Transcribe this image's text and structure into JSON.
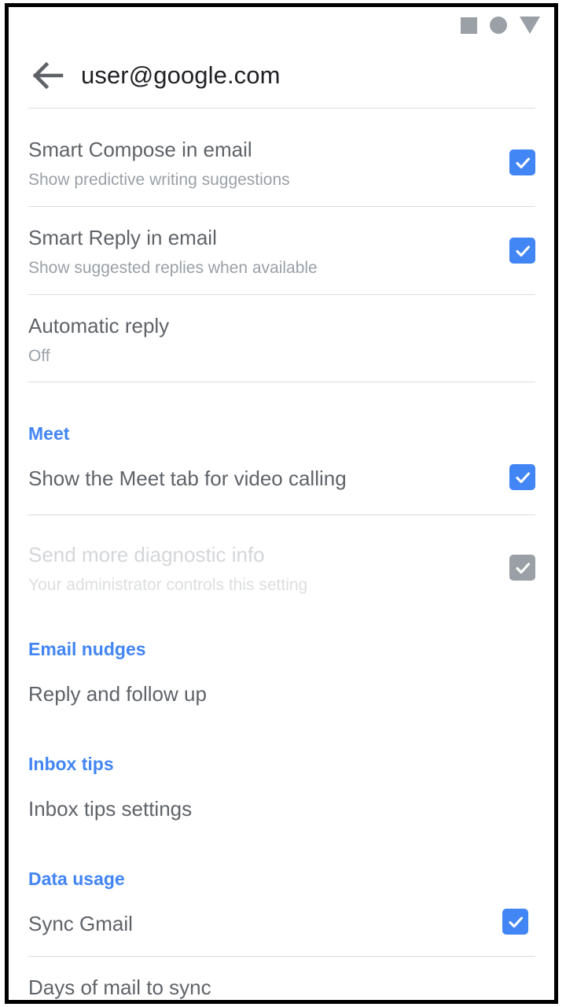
{
  "status_bar": {
    "icons": [
      "square-icon",
      "circle-icon",
      "triangle-down-icon"
    ],
    "color": "#9aa0a6"
  },
  "app_bar": {
    "back_icon": "arrow-back-icon",
    "title": "user@google.com"
  },
  "theme": {
    "accent": "#4285f4",
    "title_text": "#5f6368",
    "subtitle_text": "#9aa0a6",
    "disabled_text": "#d4d6d9",
    "disabled_checkbox": "#9aa0a6",
    "divider": "#dadce0"
  },
  "settings": [
    {
      "kind": "row",
      "title": "Smart Compose in email",
      "subtitle": "Show predictive writing suggestions",
      "checkbox": {
        "checked": true,
        "enabled": true
      }
    },
    {
      "kind": "row",
      "title": "Smart Reply in email",
      "subtitle": "Show suggested replies when available",
      "checkbox": {
        "checked": true,
        "enabled": true
      }
    },
    {
      "kind": "row",
      "title": "Automatic reply",
      "subtitle": "Off",
      "checkbox": null
    },
    {
      "kind": "section",
      "label": "Meet"
    },
    {
      "kind": "row",
      "title": "Show the Meet tab for video calling",
      "subtitle": null,
      "checkbox": {
        "checked": true,
        "enabled": true
      }
    },
    {
      "kind": "row",
      "title": "Send more diagnostic info",
      "subtitle": "Your administrator controls this setting",
      "checkbox": {
        "checked": true,
        "enabled": false
      }
    },
    {
      "kind": "section",
      "label": "Email nudges"
    },
    {
      "kind": "row",
      "title": "Reply and follow up",
      "subtitle": null,
      "checkbox": null
    },
    {
      "kind": "section",
      "label": "Inbox tips"
    },
    {
      "kind": "row",
      "title": "Inbox tips settings",
      "subtitle": null,
      "checkbox": null
    },
    {
      "kind": "section",
      "label": "Data usage"
    },
    {
      "kind": "row",
      "title": "Sync Gmail",
      "subtitle": null,
      "checkbox": {
        "checked": true,
        "enabled": true
      }
    },
    {
      "kind": "row",
      "title": "Days of mail to sync",
      "subtitle": null,
      "checkbox": null
    }
  ]
}
